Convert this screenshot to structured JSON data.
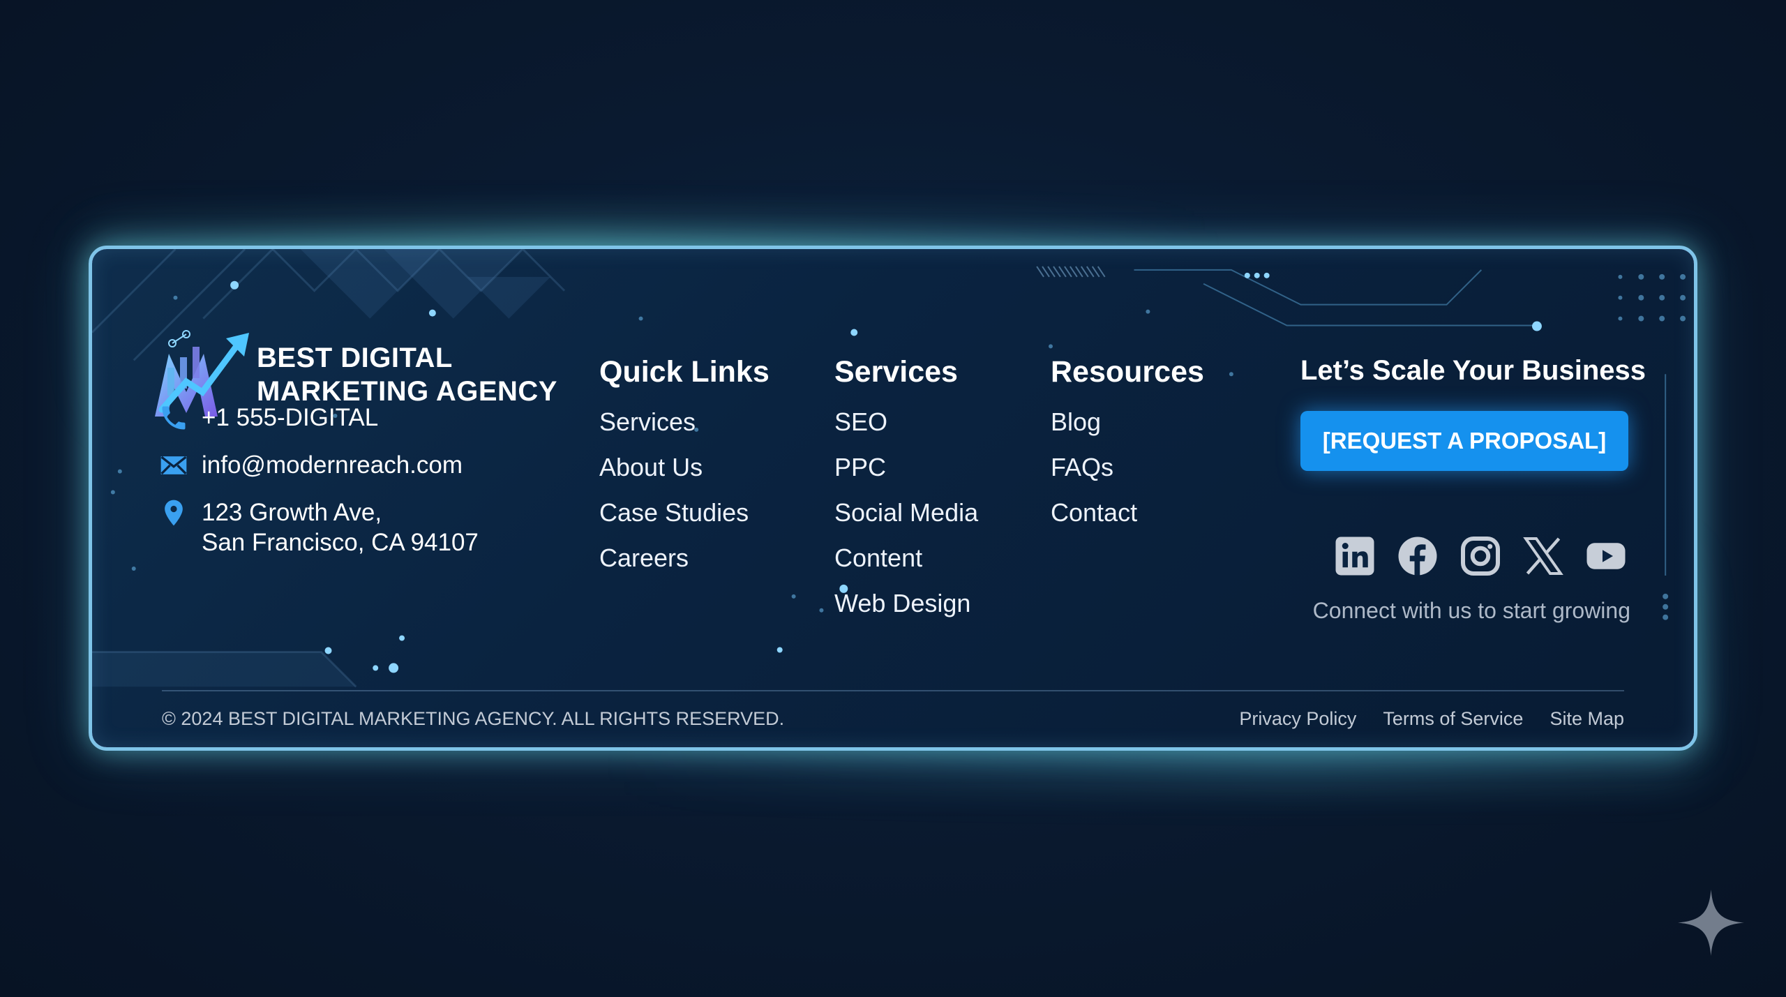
{
  "brand": {
    "name_line1": "BEST DIGITAL",
    "name_line2": "MARKETING AGENCY",
    "logo_icon": "rising-chart-m-logo"
  },
  "contact": {
    "phone": "+1 555-DIGITAL",
    "email": "info@modernreach.com",
    "address_line1": "123 Growth Ave,",
    "address_line2": "San Francisco, CA 94107",
    "icons": [
      "phone-icon",
      "mail-icon",
      "location-pin-icon"
    ]
  },
  "columns": {
    "quick_links": {
      "title": "Quick Links",
      "items": [
        "Services",
        "About Us",
        "Case Studies",
        "Careers"
      ]
    },
    "services": {
      "title": "Services",
      "items": [
        "SEO",
        "PPC",
        "Social Media",
        "Content",
        "Web Design"
      ]
    },
    "resources": {
      "title": "Resources",
      "items": [
        "Blog",
        "FAQs",
        "Contact"
      ]
    }
  },
  "cta": {
    "title": "Let’s Scale Your Business",
    "button_label": "[REQUEST A PROPOSAL]",
    "social_caption": "Connect with us to start growing",
    "social_icons": [
      "linkedin-icon",
      "facebook-icon",
      "instagram-icon",
      "x-icon",
      "youtube-icon"
    ]
  },
  "footer": {
    "copyright": "© 2024 BEST DIGITAL MARKETING AGENCY. ALL RIGHTS RESERVED.",
    "links": [
      "Privacy Policy",
      "Terms of Service",
      "Site Map"
    ]
  },
  "colors": {
    "background": "#0a1a30",
    "panel": "#0a2340",
    "accent": "#1591ee",
    "border": "#7fc4e8",
    "icon_blue": "#3aa0f0"
  }
}
